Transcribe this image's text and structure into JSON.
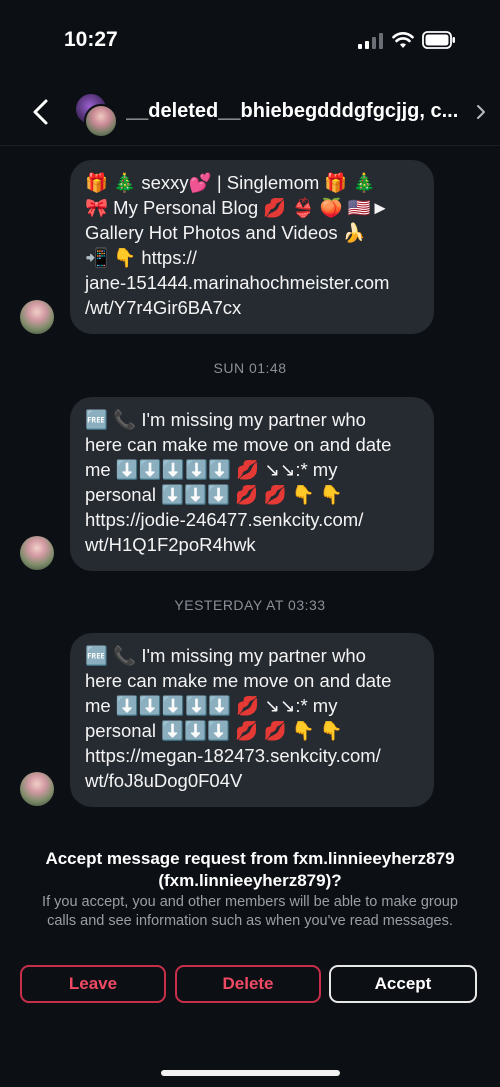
{
  "status_bar": {
    "time": "10:27"
  },
  "header": {
    "title": "__deleted__bhiebegdddgfgcjjg, c..."
  },
  "messages": [
    {
      "text": "🎁 🎄 sexxy💕 | Singlemom 🎁 🎄\n🎀 My Personal Blog 💋 👙 🍑 🇺🇸►\nGallery Hot Photos and Videos 🍌\n📲 👇 https://\njane-151444.marinahochmeister.com\n/wt/Y7r4Gir6BA7cx"
    },
    {
      "timestamp": "SUN 01:48"
    },
    {
      "text": "🆓 📞 I'm missing my partner who\nhere can make me move on and date\nme ⬇️⬇️⬇️⬇️⬇️ 💋 ↘↘:* my\npersonal ⬇️⬇️⬇️ 💋 💋 👇 👇\nhttps://jodie-246477.senkcity.com/\nwt/H1Q1F2poR4hwk"
    },
    {
      "timestamp": "YESTERDAY AT 03:33"
    },
    {
      "text": "🆓 📞 I'm missing my partner who\nhere can make me move on and date\nme ⬇️⬇️⬇️⬇️⬇️ 💋 ↘↘:* my\npersonal ⬇️⬇️⬇️ 💋 💋 👇 👇\nhttps://megan-182473.senkcity.com/\nwt/foJ8uDog0F04V"
    }
  ],
  "request": {
    "title": "Accept message request from fxm.linnieeyherz879 (fxm.linnieeyherz879)?",
    "description": "If you accept, you and other members will be able to make group calls and see information such as when you've read messages.",
    "leave_label": "Leave",
    "delete_label": "Delete",
    "accept_label": "Accept"
  },
  "colors": {
    "danger": "#ef4a64",
    "bubble": "#262a31",
    "background": "#0c0f14"
  }
}
